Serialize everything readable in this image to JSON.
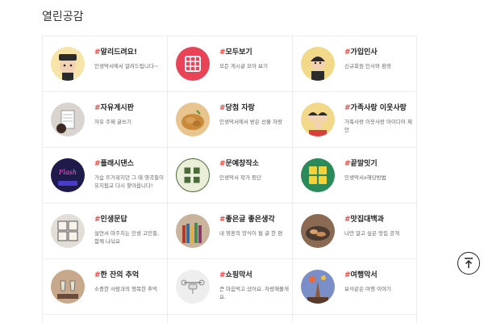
{
  "section_title": "열린공감",
  "hash": "#",
  "cards": [
    {
      "title": "알리드려요!",
      "desc": "인생막서에서 알려드립니다~",
      "icon": "officer-character-icon",
      "bg": "#f6e4a8"
    },
    {
      "title": "모두보기",
      "desc": "모든 게시글 모아 보기",
      "icon": "grid-all-icon",
      "bg": "#e84356"
    },
    {
      "title": "가입인사",
      "desc": "신규회원 인사와 환영",
      "icon": "greeting-character-icon",
      "bg": "#f2d98a"
    },
    {
      "title": "자유게시판",
      "desc": "자유 주제 글쓰기",
      "icon": "notebook-pen-icon",
      "bg": "#d9d4cf"
    },
    {
      "title": "당첨 자랑",
      "desc": "인생막서에서 받은 선물 자랑",
      "icon": "fried-chicken-icon",
      "bg": "#e8c48e"
    },
    {
      "title": "가족사랑 이웃사랑",
      "desc": "가족사랑 이웃사랑 아이디어 제안",
      "icon": "family-character-icon",
      "bg": "#f2d98a"
    },
    {
      "title": "플래시댄스",
      "desc": "가슴 뜨거워지던 그 때 영곡들이 유지됩교 다시 찾아옵니다!",
      "icon": "flashdance-poster-icon",
      "bg": "#1e1a4a"
    },
    {
      "title": "문예창작소",
      "desc": "인생막서 작가 등단",
      "icon": "literary-workshop-icon",
      "bg": "#e9efd9"
    },
    {
      "title": "끝말잇기",
      "desc": "인생막서x해당방법",
      "icon": "word-chain-icon",
      "bg": "#2b8a5a"
    },
    {
      "title": "인생문답",
      "desc": "설연서 마주치는 인생 고민들, 함께 나눠요",
      "icon": "qa-tiles-icon",
      "bg": "#e2ddd6"
    },
    {
      "title": "좋은글 좋은생각",
      "desc": "내 영혼의 양식이 될 글 한 편",
      "icon": "books-icon",
      "bg": "#c9b39a"
    },
    {
      "title": "맛집대백과",
      "desc": "나만 알고 싶은 맛집 공개",
      "icon": "grilled-meat-icon",
      "bg": "#8a6a52"
    },
    {
      "title": "한 잔의 추억",
      "desc": "소중한 사람과의 행복한 추억",
      "icon": "toast-glasses-icon",
      "bg": "#c8a88a"
    },
    {
      "title": "쇼핑막서",
      "desc": "큰 마음먹고 샀어요. 자랑해볼게요.",
      "icon": "drone-icon",
      "bg": "#eeeeee"
    },
    {
      "title": "여행막서",
      "desc": "보석같은 여행 이야기",
      "icon": "balloon-temple-icon",
      "bg": "#7a8fc8"
    }
  ],
  "scroll_top_icon": "arrow-up-icon"
}
